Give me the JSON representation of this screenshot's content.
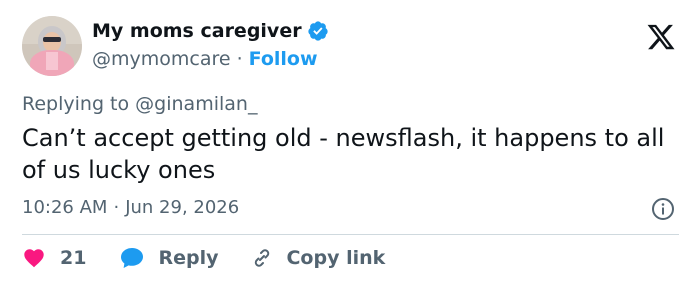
{
  "author": {
    "display_name": "My moms caregiver",
    "handle": "@mymomcare",
    "separator": "·",
    "follow_label": "Follow"
  },
  "reply_context": {
    "prefix": "Replying to",
    "mention": "@ginamilan_"
  },
  "tweet": {
    "text": "Can’t accept getting old - newsflash, it happens to all of us lucky ones"
  },
  "meta": {
    "time": "10:26 AM",
    "separator": "·",
    "date": "Jun 29, 2026"
  },
  "actions": {
    "like_count": "21",
    "reply_label": "Reply",
    "copy_label": "Copy link"
  },
  "colors": {
    "like": "#f91880",
    "reply": "#1d9bf0",
    "verified": "#1d9bf0",
    "muted": "#536471"
  },
  "icons": {
    "verified": "verified-badge-icon",
    "platform": "x-logo-icon",
    "info": "info-icon",
    "like": "heart-icon",
    "reply": "speech-bubble-icon",
    "copy": "link-icon"
  }
}
